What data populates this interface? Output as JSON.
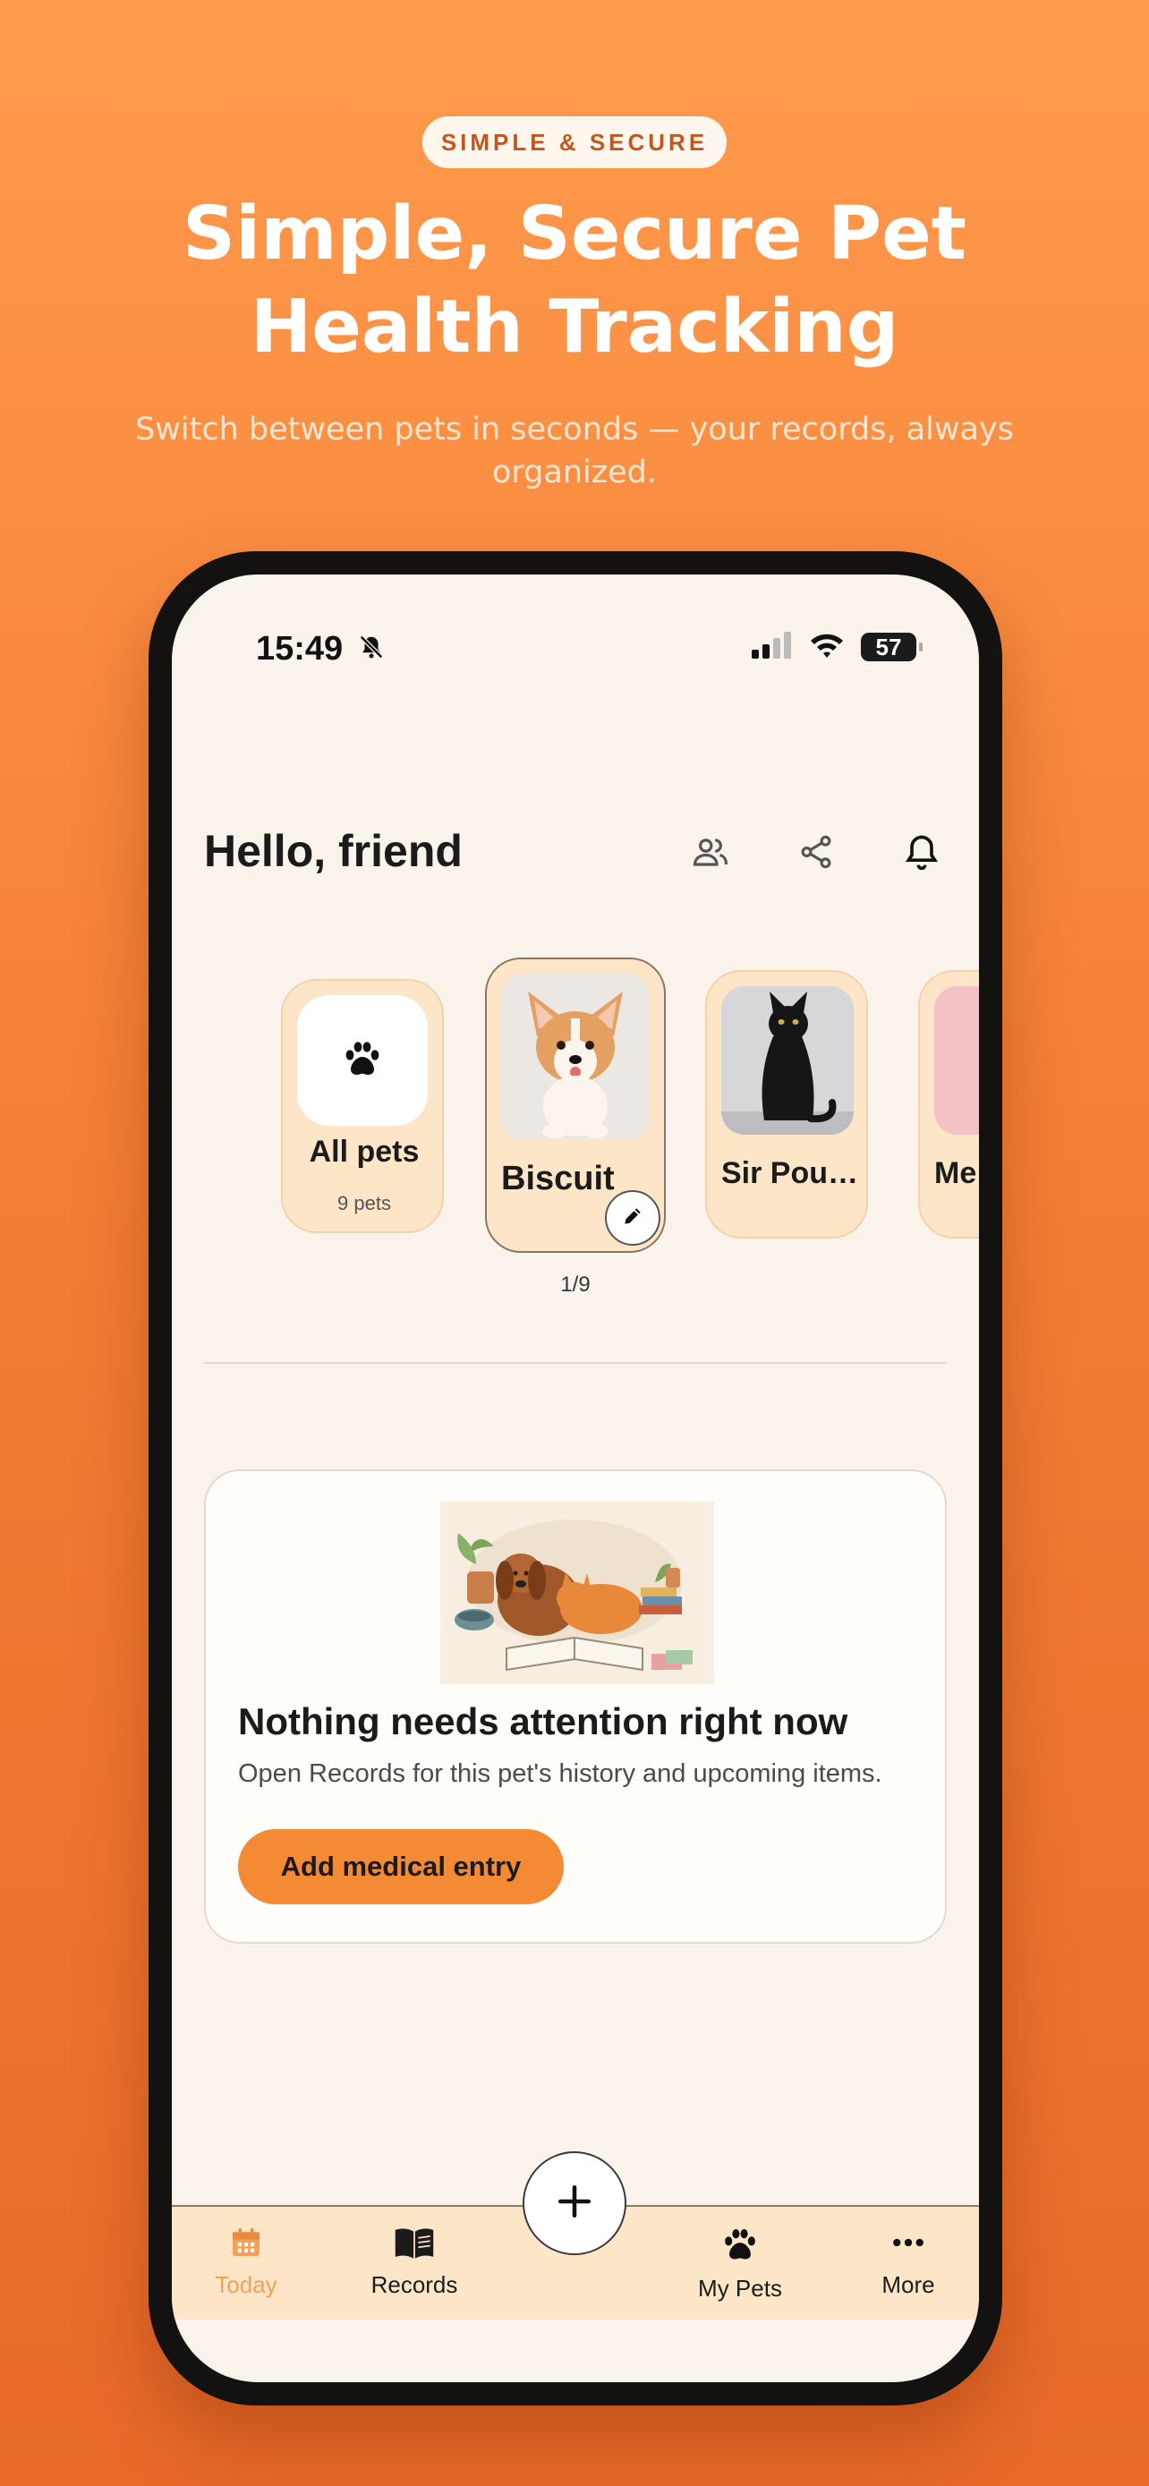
{
  "promo": {
    "badge": "SIMPLE & SECURE",
    "headline_line1": "Simple, Secure Pet",
    "headline_line2": "Health Tracking",
    "subline": "Switch between pets in seconds — your records, always organized."
  },
  "status_bar": {
    "time": "15:49",
    "battery": "57"
  },
  "header": {
    "greeting": "Hello, friend",
    "icons": [
      "people-icon",
      "share-icon",
      "bell-icon"
    ]
  },
  "pets": {
    "all": {
      "label": "All pets",
      "count": "9 pets"
    },
    "items": [
      {
        "name": "Biscuit",
        "selected": true
      },
      {
        "name": "Sir Pou…",
        "selected": false
      },
      {
        "name": "Me",
        "selected": false
      }
    ],
    "pager": "1/9"
  },
  "attention_card": {
    "title": "Nothing needs attention right now",
    "text": "Open Records for this pet's history and upcoming items.",
    "button": "Add medical entry"
  },
  "tabbar": {
    "tabs": [
      {
        "label": "Today",
        "icon": "calendar-icon",
        "active": true
      },
      {
        "label": "Records",
        "icon": "book-icon",
        "active": false
      },
      {
        "label": "My Pets",
        "icon": "paw-icon",
        "active": false
      },
      {
        "label": "More",
        "icon": "more-icon",
        "active": false
      }
    ],
    "fab_icon": "plus-icon"
  },
  "colors": {
    "accent": "#f58a35",
    "active_tab": "#f5a05a",
    "card_bg": "#fde6c8",
    "screen_bg": "#faf3ec"
  }
}
